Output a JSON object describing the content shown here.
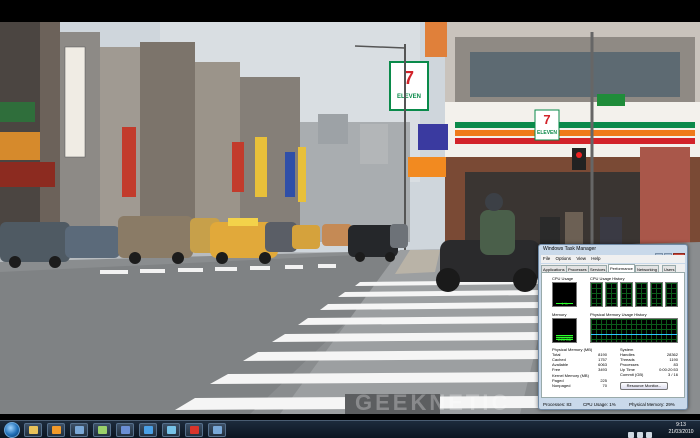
{
  "scene": {
    "store_name": "ELEVEN",
    "store_number": "7"
  },
  "watermark": "GEEKNETIC",
  "task_manager": {
    "title": "Windows Task Manager",
    "menu": [
      "File",
      "Options",
      "View",
      "Help"
    ],
    "tabs": [
      "Applications",
      "Processes",
      "Services",
      "Performance",
      "Networking",
      "Users"
    ],
    "active_tab": "Performance",
    "cpu_usage_label": "CPU Usage",
    "cpu_history_label": "CPU Usage History",
    "memory_label": "Memory",
    "memory_history_label": "Physical Memory Usage History",
    "cpu_usage_value": "1 %",
    "cpu_usage_fraction": 0.02,
    "memory_value": "2.26 GB",
    "memory_fraction": 0.3,
    "physical_memory": {
      "heading": "Physical Memory (MB)",
      "rows": [
        {
          "k": "Total",
          "v": "8190"
        },
        {
          "k": "Cached",
          "v": "1757"
        },
        {
          "k": "Available",
          "v": "6063"
        },
        {
          "k": "Free",
          "v": "3493"
        }
      ]
    },
    "system": {
      "heading": "System",
      "rows": [
        {
          "k": "Handles",
          "v": "28362"
        },
        {
          "k": "Threads",
          "v": "1190"
        },
        {
          "k": "Processes",
          "v": "83"
        },
        {
          "k": "Up Time",
          "v": "0:00:20:53"
        },
        {
          "k": "Commit (GB)",
          "v": "3 / 16"
        }
      ]
    },
    "kernel_memory": {
      "heading": "Kernel Memory (MB)",
      "rows": [
        {
          "k": "Paged",
          "v": "225"
        },
        {
          "k": "Nonpaged",
          "v": "70"
        }
      ]
    },
    "resource_monitor_button": "Resource Monitor...",
    "status": {
      "processes": "Processes: 83",
      "cpu": "CPU Usage: 1%",
      "memory": "Physical Memory: 29%"
    }
  },
  "taskbar": {
    "time": "9:13",
    "date": "21/03/2010",
    "pinned": [
      {
        "name": "explorer",
        "color": "#e8c25a"
      },
      {
        "name": "media-player",
        "color": "#f39a2a"
      },
      {
        "name": "app-1",
        "color": "#7aa7d6"
      },
      {
        "name": "app-2",
        "color": "#9ad06a"
      },
      {
        "name": "app-3",
        "color": "#6b8fd6"
      },
      {
        "name": "internet-explorer",
        "color": "#4aa0e6"
      },
      {
        "name": "app-4",
        "color": "#76c2e8"
      },
      {
        "name": "app-5",
        "color": "#d9342b"
      },
      {
        "name": "app-6",
        "color": "#79a8d8"
      }
    ]
  }
}
